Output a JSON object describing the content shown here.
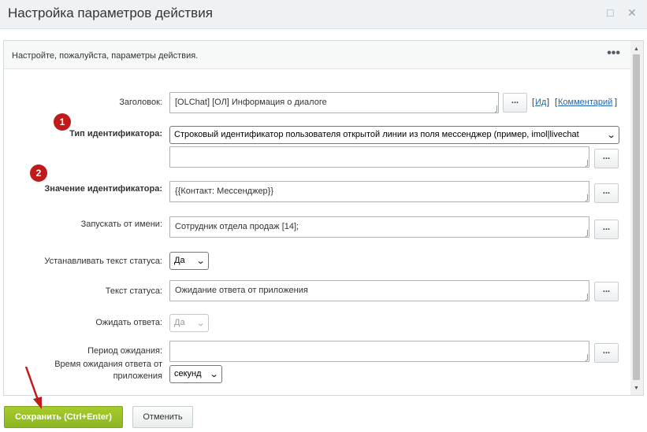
{
  "window": {
    "title": "Настройка параметров действия",
    "maximize_glyph": "□",
    "close_glyph": "✕"
  },
  "panel": {
    "description": "Настройте, пожалуйста, параметры действия.",
    "menu_glyph": "•••"
  },
  "form": {
    "title_label": "Заголовок:",
    "title_value": "[OLChat] [ОЛ] Информация о диалоге",
    "id_link": "Ид",
    "comment_link": "Комментарий",
    "id_type_label": "Тип идентификатора:",
    "id_type_value": "Строковый идентификатор пользователя открытой линии из поля мессенджер (пример, imol|livechat",
    "id_type_extra_value": "",
    "id_value_label": "Значение идентификатора:",
    "id_value_value": "{{Контакт: Мессенджер}}",
    "run_as_label": "Запускать от имени:",
    "run_as_value": "Сотрудник отдела продаж [14];",
    "set_status_label": "Устанавливать текст статуса:",
    "set_status_value": "Да",
    "status_text_label": "Текст статуса:",
    "status_text_value": "Ожидание ответа от приложения",
    "wait_answer_label": "Ожидать ответа:",
    "wait_answer_value": "Да",
    "wait_period_label": "Период ожидания:",
    "wait_period_value": "",
    "wait_time_label": "Время ожидания ответа от приложения",
    "wait_time_unit": "секунд",
    "dots_label": "..."
  },
  "badges": [
    "1",
    "2"
  ],
  "footer": {
    "save_label": "Сохранить (Ctrl+Enter)",
    "cancel_label": "Отменить"
  },
  "colors": {
    "save_green": "#8db624",
    "badge_red": "#c01b1b",
    "link_blue": "#2067b0"
  }
}
